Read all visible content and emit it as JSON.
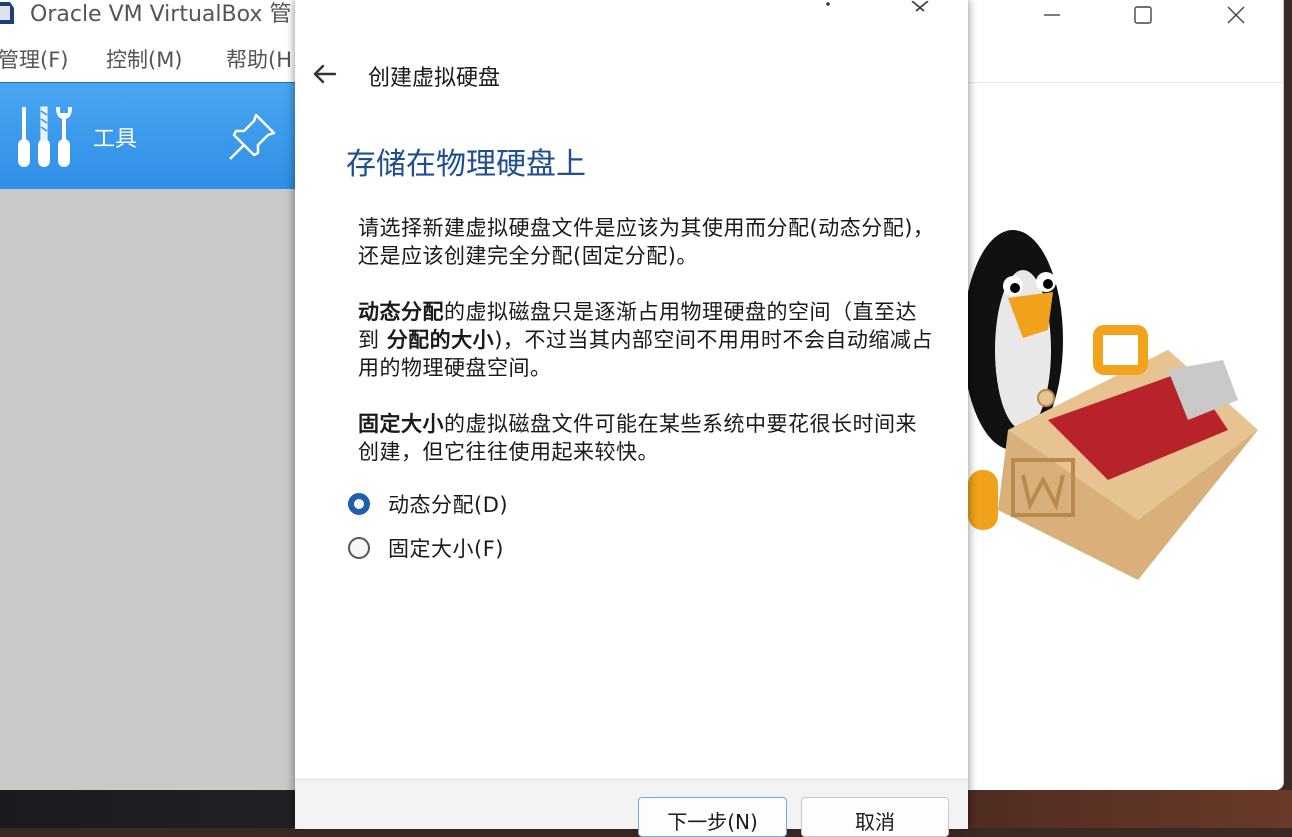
{
  "window": {
    "title": "Oracle VM VirtualBox 管",
    "menu": [
      "管理(F)",
      "控制(M)",
      "帮助(H"
    ]
  },
  "toolbar": {
    "tools_label": "工具"
  },
  "dialog": {
    "header_title": "创建虚拟硬盘",
    "heading": "存储在物理硬盘上",
    "para1": "请选择新建虚拟硬盘文件是应该为其使用而分配(动态分配)，还是应该创建完全分配(固定分配)。",
    "para2_bold1": "动态分配",
    "para2_text1": "的虚拟磁盘只是逐渐占用物理硬盘的空间（直至达到 ",
    "para2_bold2": "分配的大小",
    "para2_text2": ")，不过当其内部空间不用用时不会自动缩减占用的物理硬盘空间。",
    "para3_bold": "固定大小",
    "para3_text": "的虚拟磁盘文件可能在某些系统中要花很长时间来创建，但它往往使用起来较快。",
    "options": [
      {
        "label": "动态分配(D)",
        "checked": true
      },
      {
        "label": "固定大小(F)",
        "checked": false
      }
    ],
    "next_button": "下一步(N)",
    "cancel_button": "取消"
  },
  "colors": {
    "accent": "#1f5fae",
    "heading": "#1f4e91",
    "toolbar": "#2f8fe6"
  }
}
